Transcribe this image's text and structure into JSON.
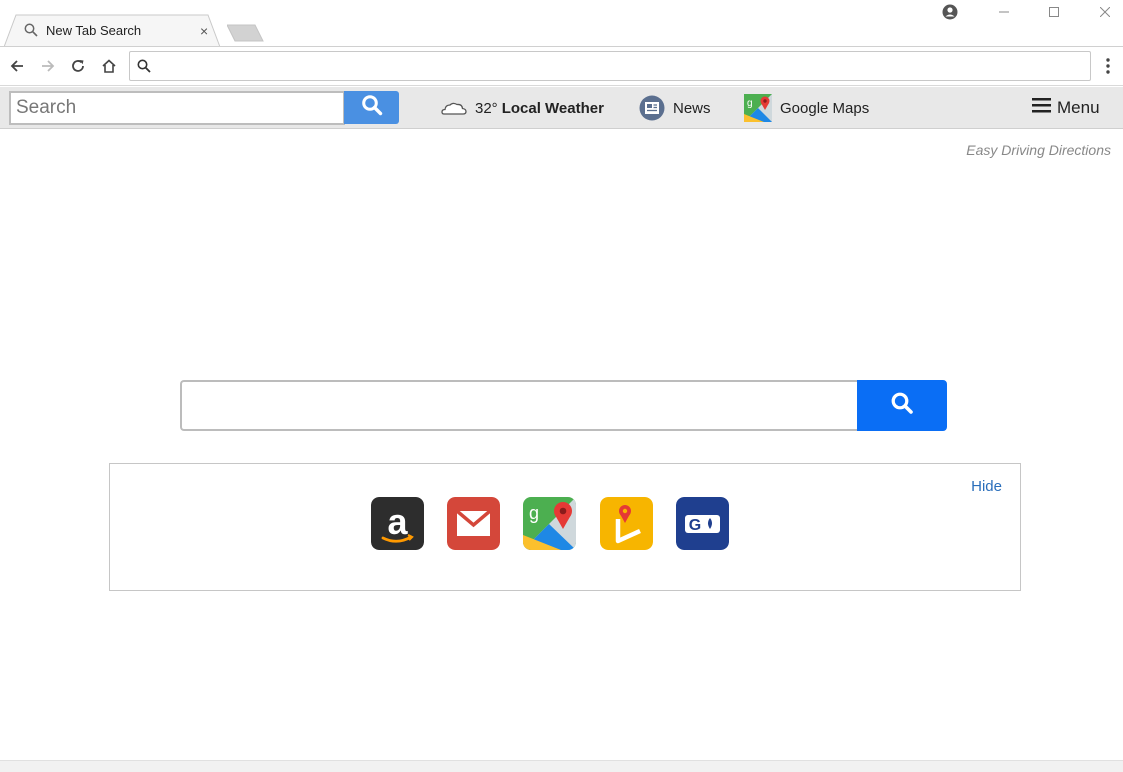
{
  "browser": {
    "tab_title": "New Tab Search",
    "tab_close_glyph": "×",
    "address_value": "",
    "icons": [
      "search-icon",
      "back-icon",
      "forward-icon",
      "reload-icon",
      "home-icon",
      "profile-icon",
      "minimize-icon",
      "maximize-icon",
      "close-icon",
      "more-icon"
    ]
  },
  "extension_bar": {
    "search_placeholder": "Search",
    "weather_temp": "32°",
    "weather_label": "Local Weather",
    "news_label": "News",
    "maps_label": "Google Maps",
    "menu_label": "Menu"
  },
  "page": {
    "brand": "Easy Driving Directions",
    "main_search_value": "",
    "hide_label": "Hide",
    "shortcuts": [
      {
        "name": "amazon",
        "icon": "amazon-icon",
        "color": "#2d2d2d"
      },
      {
        "name": "gmail",
        "icon": "mail-icon",
        "color": "#d4473a"
      },
      {
        "name": "google-maps",
        "icon": "maps-icon",
        "color": "#4caf50"
      },
      {
        "name": "directions",
        "icon": "directions-icon",
        "color": "#f7b500"
      },
      {
        "name": "gas",
        "icon": "gas-icon",
        "color": "#1f3f8f"
      }
    ]
  },
  "colors": {
    "ext_button": "#4a90e2",
    "main_button": "#0a6ef5",
    "link": "#2a6ebb"
  }
}
